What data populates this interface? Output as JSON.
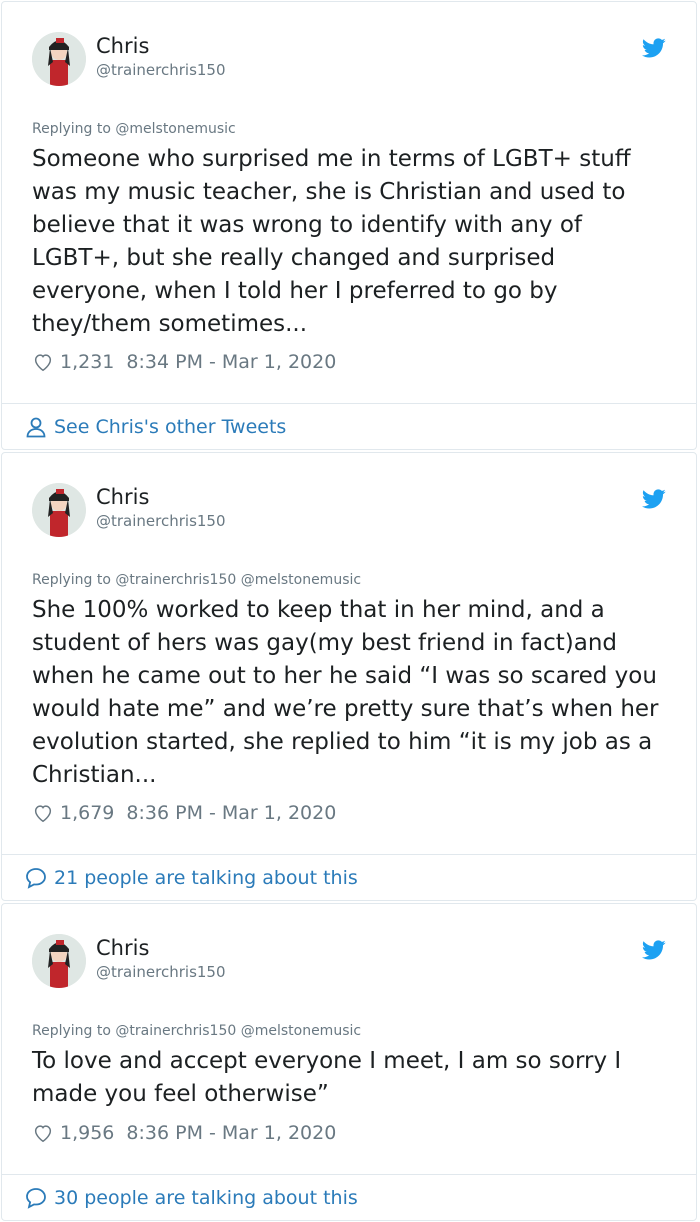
{
  "tweets": [
    {
      "name": "Chris",
      "handle": "@trainerchris150",
      "replying": "Replying to @melstonemusic",
      "text": "Someone who surprised me in terms of LGBT+ stuff was my music teacher, she is Christian and used to believe that it was wrong to identify with any of LGBT+, but she really changed and surprised everyone, when I told her I preferred to go by they/them sometimes...",
      "likes": "1,231",
      "time": "8:34 PM - Mar 1, 2020",
      "footer": "See Chris's other Tweets",
      "footer_icon": "person-icon"
    },
    {
      "name": "Chris",
      "handle": "@trainerchris150",
      "replying": "Replying to @trainerchris150 @melstonemusic",
      "text": "She 100% worked to keep that in her mind, and a student of hers was gay(my best friend in fact)and when he came out to her he said “I was so scared you would hate me” and we’re pretty sure that’s when her evolution started, she replied to him “it is my job as a Christian...",
      "likes": "1,679",
      "time": "8:36 PM - Mar 1, 2020",
      "footer": "21 people are talking about this",
      "footer_icon": "speech-bubble-icon"
    },
    {
      "name": "Chris",
      "handle": "@trainerchris150",
      "replying": "Replying to @trainerchris150 @melstonemusic",
      "text": "To love and accept everyone I meet, I am so sorry I made you feel otherwise”",
      "likes": "1,956",
      "time": "8:36 PM - Mar 1, 2020",
      "footer": "30 people are talking about this",
      "footer_icon": "speech-bubble-icon"
    }
  ],
  "colors": {
    "accent": "#2b7bb9",
    "twitter": "#1da1f2",
    "muted": "#697882",
    "text": "#1c2022",
    "border": "#e1e8ed"
  }
}
